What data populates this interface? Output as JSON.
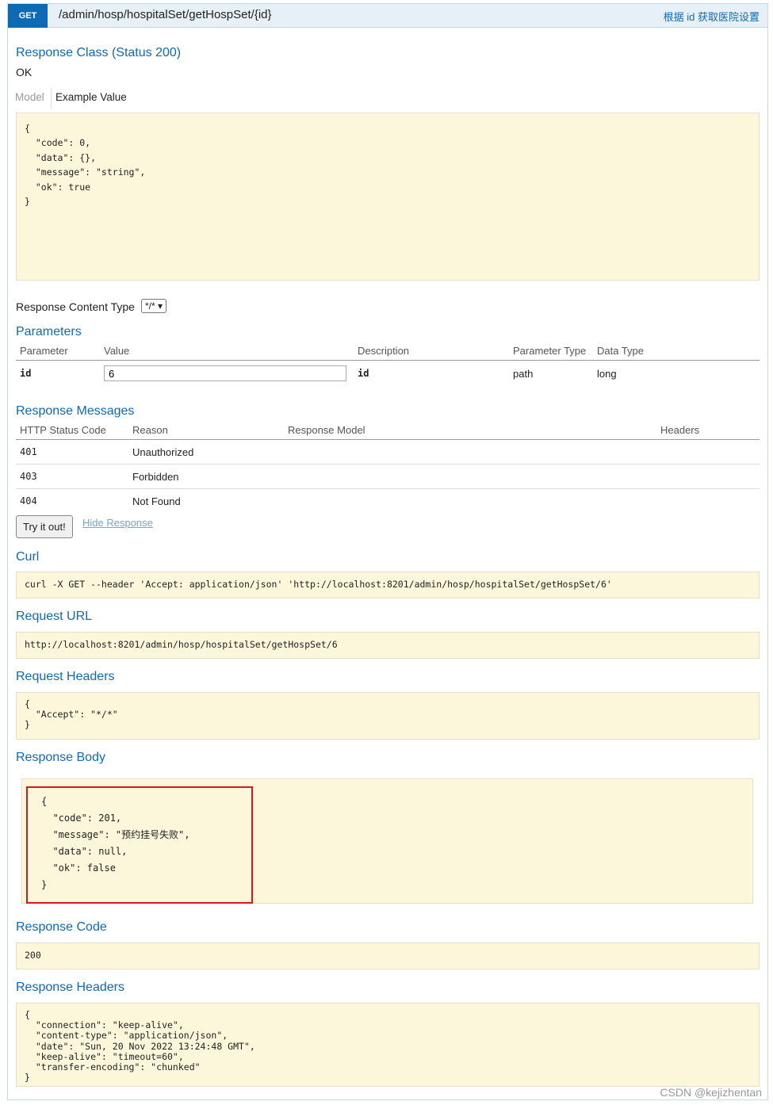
{
  "op": {
    "method": "GET",
    "path": "/admin/hosp/hospitalSet/getHospSet/{id}",
    "summary": "根据 id 获取医院设置"
  },
  "response_class": {
    "title": "Response Class (Status 200)",
    "status_text": "OK",
    "tab_model": "Model",
    "tab_example": "Example Value",
    "example_lines": [
      "{",
      "  \"code\": 0,",
      "  \"data\": {},",
      "  \"message\": \"string\",",
      "  \"ok\": true",
      "}"
    ]
  },
  "content_type": {
    "label": "Response Content Type",
    "value": "*/*"
  },
  "parameters": {
    "title": "Parameters",
    "headers": [
      "Parameter",
      "Value",
      "Description",
      "Parameter Type",
      "Data Type"
    ],
    "rows": [
      {
        "name": "id",
        "value": "6",
        "description": "id",
        "param_type": "path",
        "data_type": "long"
      }
    ]
  },
  "response_messages": {
    "title": "Response Messages",
    "headers": [
      "HTTP Status Code",
      "Reason",
      "Response Model",
      "Headers"
    ],
    "rows": [
      {
        "code": "401",
        "reason": "Unauthorized"
      },
      {
        "code": "403",
        "reason": "Forbidden"
      },
      {
        "code": "404",
        "reason": "Not Found"
      }
    ]
  },
  "actions": {
    "try_label": "Try it out!",
    "hide_label": "Hide Response"
  },
  "curl": {
    "title": "Curl",
    "value": "curl -X GET --header 'Accept: application/json' 'http://localhost:8201/admin/hosp/hospitalSet/getHospSet/6'"
  },
  "request_url": {
    "title": "Request URL",
    "value": "http://localhost:8201/admin/hosp/hospitalSet/getHospSet/6"
  },
  "request_headers": {
    "title": "Request Headers",
    "lines": [
      "{",
      "  \"Accept\": \"*/*\"",
      "}"
    ]
  },
  "response_body": {
    "title": "Response Body",
    "lines": [
      "{",
      "  \"code\": 201,",
      "  \"message\": \"预约挂号失败\",",
      "  \"data\": null,",
      "  \"ok\": false",
      "}"
    ]
  },
  "response_code": {
    "title": "Response Code",
    "value": "200"
  },
  "response_headers": {
    "title": "Response Headers",
    "lines": [
      "{",
      "  \"connection\": \"keep-alive\",",
      "  \"content-type\": \"application/json\",",
      "  \"date\": \"Sun, 20 Nov 2022 13:24:48 GMT\",",
      "  \"keep-alive\": \"timeout=60\",",
      "  \"transfer-encoding\": \"chunked\"",
      "}"
    ]
  },
  "watermark": "CSDN @kejizhentan",
  "colors": {
    "accent": "#0f6ab4",
    "highlight_box": "#d9191e",
    "code_bg": "#fcf6db"
  }
}
